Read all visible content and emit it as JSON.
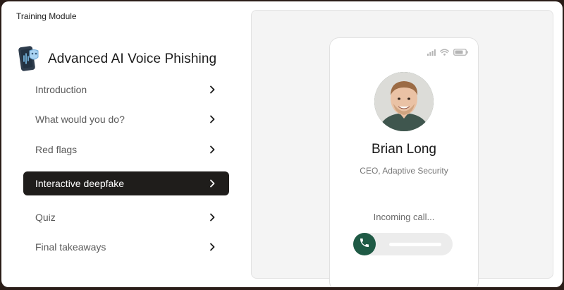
{
  "header": {
    "module_label": "Training Module"
  },
  "module": {
    "title": "Advanced AI Voice Phishing",
    "logo_icon": "phone-voice-mask-icon"
  },
  "nav": {
    "items": [
      {
        "label": "Introduction",
        "active": false
      },
      {
        "label": "What would you do?",
        "active": false
      },
      {
        "label": "Red flags",
        "active": false
      },
      {
        "label": "Interactive deepfake",
        "active": true
      },
      {
        "label": "Quiz",
        "active": false
      },
      {
        "label": "Final takeaways",
        "active": false
      }
    ]
  },
  "call": {
    "caller_name": "Brian Long",
    "caller_title": "CEO, Adaptive Security",
    "status": "Incoming call...",
    "answer_icon": "phone-icon"
  },
  "colors": {
    "active_nav_bg": "#1f1d1b",
    "answer_button": "#1f5a45",
    "panel_bg": "#f4f4f4"
  }
}
